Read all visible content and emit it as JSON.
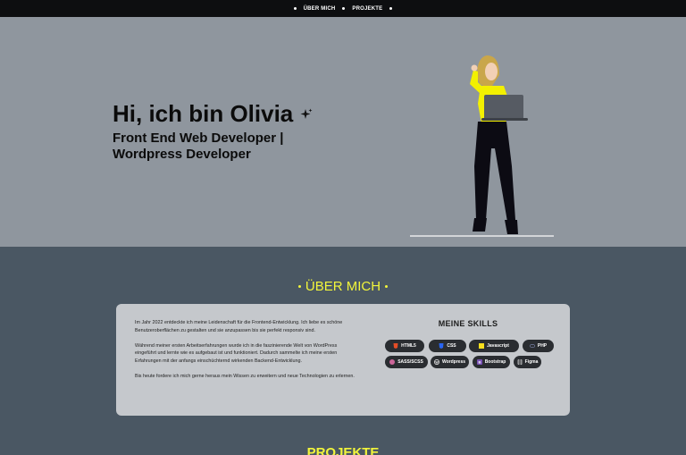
{
  "nav": {
    "items": [
      {
        "label": "ÜBER MICH"
      },
      {
        "label": "PROJEKTE"
      }
    ]
  },
  "hero": {
    "title": "Hi, ich bin Olivia",
    "subtitle": "Front End Web Developer | Wordpress Developer"
  },
  "about": {
    "heading": "ÜBER MICH",
    "paragraphs": [
      "Im Jahr 2022 entdeckte ich meine Leidenschaft für die Frontend-Entwicklung. Ich liebe es schöne Benutzeroberflächen zu gestalten und sie anzupassen bis sie perfekt responsiv sind.",
      "Während meiner ersten Arbeitserfahrungen wurde ich in die faszinierende Welt von WordPress eingeführt und lernte wie es aufgebaut ist und funktioniert. Dadurch sammelte ich meine ersten Erfahrungen mit der anfangs einschüchternd wirkenden Backend-Entwicklung.",
      "Bis heute fordere ich mich gerne heraus mein Wissen zu erweitern und neue Technologien zu erlernen."
    ],
    "skills_title": "MEINE SKILLS",
    "skills": [
      {
        "label": "HTML5",
        "icon": "html5-icon",
        "color": "#e44d26"
      },
      {
        "label": "CSS",
        "icon": "css3-icon",
        "color": "#2965f1"
      },
      {
        "label": "Javascript",
        "icon": "javascript-icon",
        "color": "#f7df1e"
      },
      {
        "label": "PHP",
        "icon": "php-icon",
        "color": "#8892be"
      },
      {
        "label": "SASS/SCSS",
        "icon": "sass-icon",
        "color": "#cc6699"
      },
      {
        "label": "Wordpress",
        "icon": "wordpress-icon",
        "color": "#21759b"
      },
      {
        "label": "Bootstrap",
        "icon": "bootstrap-icon",
        "color": "#7952b3"
      },
      {
        "label": "Figma",
        "icon": "figma-icon",
        "color": "#ffffff"
      }
    ]
  },
  "projects": {
    "heading": "PROJEKTE"
  },
  "colors": {
    "accent": "#f2f53b",
    "nav_bg": "#0d0e10",
    "hero_bg": "#8f969e",
    "section_bg": "#4a5763",
    "card_bg": "#c5c8cc",
    "pill_bg": "#2a2d31"
  }
}
